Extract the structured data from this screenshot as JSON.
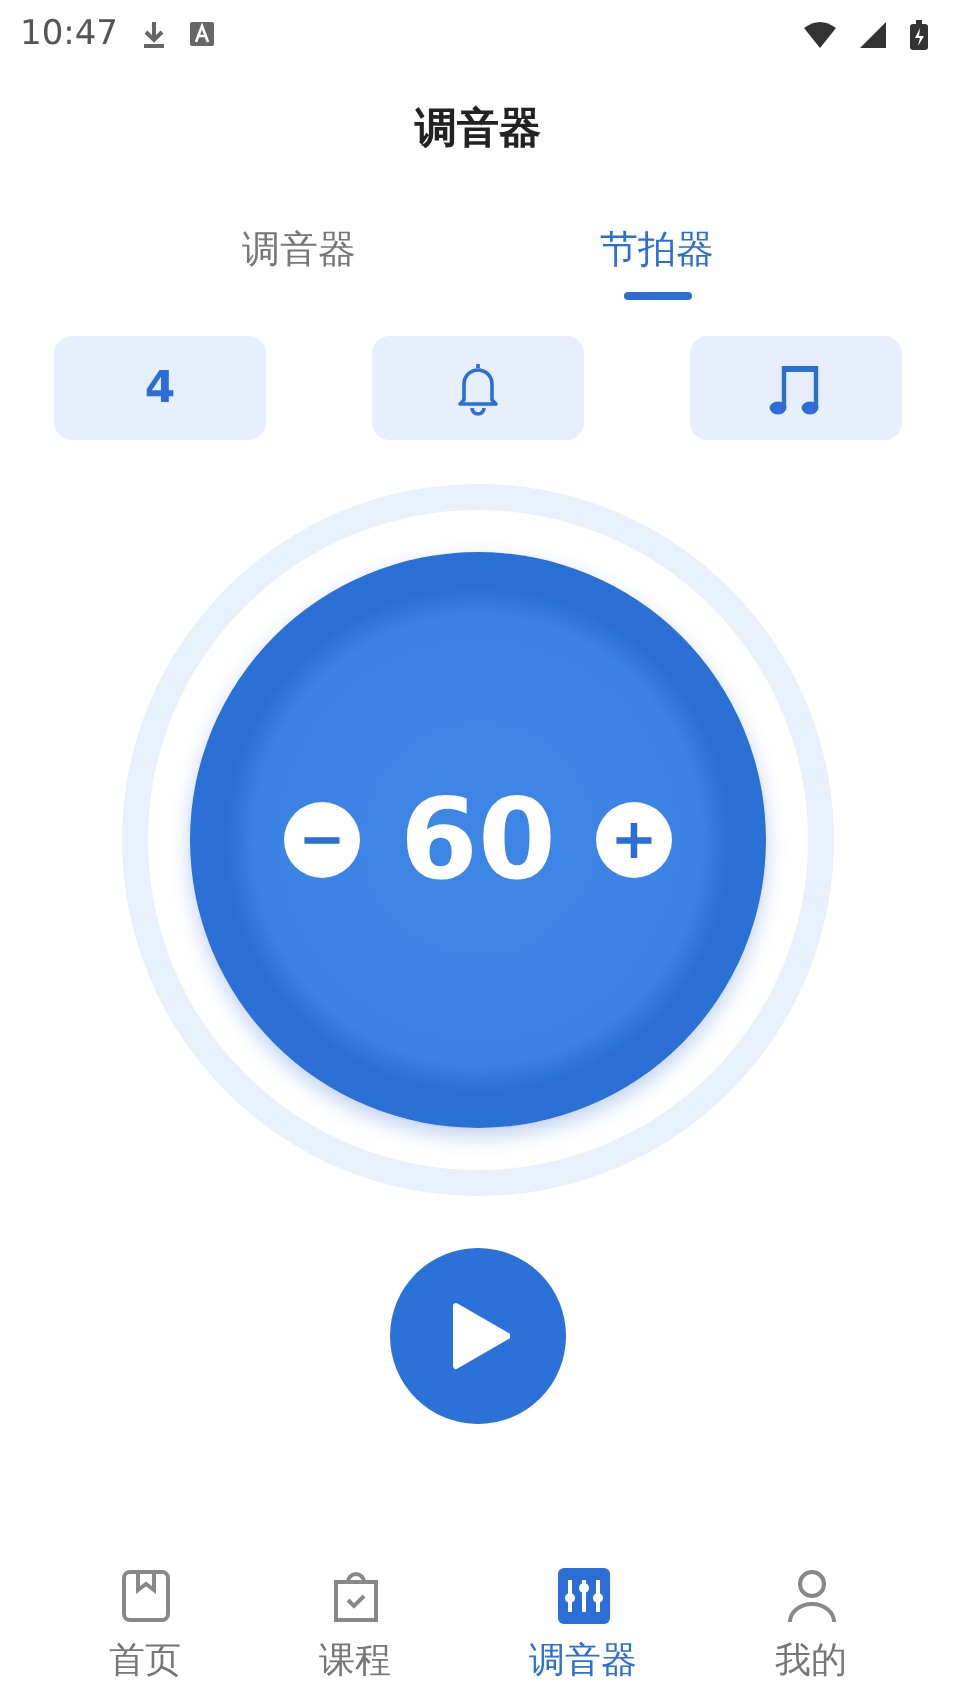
{
  "status_bar": {
    "time": "10:47"
  },
  "title": "调音器",
  "tabs": [
    {
      "label": "调音器",
      "selected": false
    },
    {
      "label": "节拍器",
      "selected": true
    }
  ],
  "options": [
    {
      "kind": "text",
      "label": "4"
    },
    {
      "kind": "bell"
    },
    {
      "kind": "note"
    }
  ],
  "tempo": {
    "value": "60",
    "minus": "−",
    "plus": "+"
  },
  "nav": [
    {
      "label": "首页",
      "kind": "book",
      "selected": false
    },
    {
      "label": "课程",
      "kind": "bag",
      "selected": false
    },
    {
      "label": "调音器",
      "kind": "tuner",
      "selected": true
    },
    {
      "label": "我的",
      "kind": "person",
      "selected": false
    }
  ]
}
